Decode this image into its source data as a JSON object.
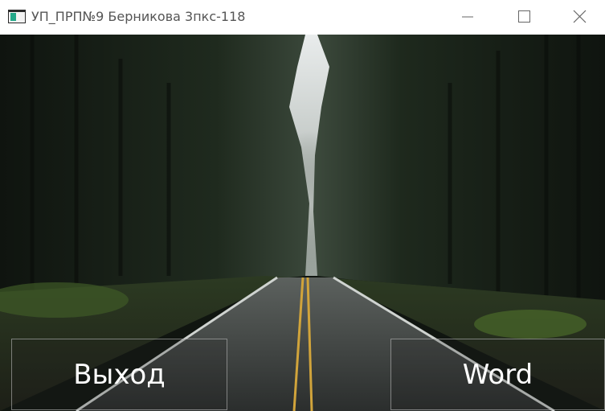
{
  "window": {
    "title": "УП_ПРП№9 Берникова 3пкс-118",
    "controls": [
      "minimize-icon",
      "maximize-icon",
      "close-icon"
    ]
  },
  "background": {
    "description_icon": "forest-road-photo"
  },
  "buttons": {
    "exit_label": "Выход",
    "word_label": "Word"
  }
}
